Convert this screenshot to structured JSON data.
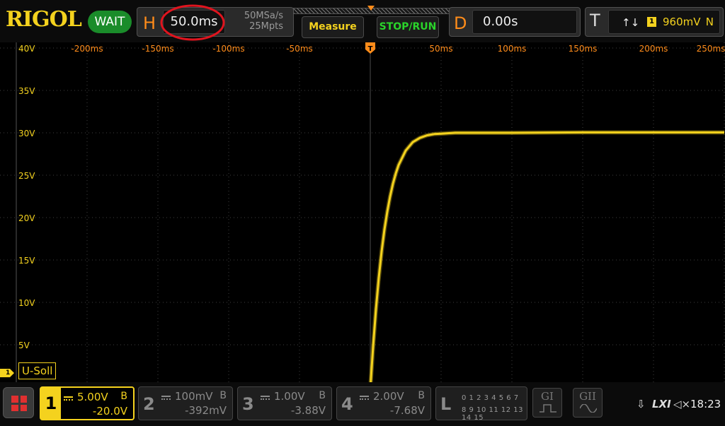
{
  "header": {
    "brand": "RIGOL",
    "run_status": "WAIT",
    "horizontal": {
      "letter": "H",
      "timebase": "50.0ms",
      "sample_rate": "50MSa/s",
      "memory_depth": "25Mpts"
    },
    "buttons": {
      "measure": "Measure",
      "stop_run": "STOP/RUN"
    },
    "delay": {
      "letter": "D",
      "value": "0.00s"
    },
    "trigger": {
      "letter": "T",
      "edge_symbol": "↑↓",
      "source": "1",
      "level": "960mV",
      "mode": "N"
    }
  },
  "screen": {
    "x_ticks": [
      "-200ms",
      "-150ms",
      "-100ms",
      "-50ms",
      "50ms",
      "100ms",
      "150ms",
      "200ms",
      "250ms"
    ],
    "y_ticks": [
      "40V",
      "35V",
      "30V",
      "25V",
      "20V",
      "15V",
      "10V",
      "5V"
    ],
    "channel_label": "U-Soll",
    "channel_marker": "1",
    "trace_color": "#f4d21e",
    "grid_color": "#404040",
    "highlight_color": "#e0141e"
  },
  "chart_data": {
    "type": "line",
    "xlabel": "",
    "ylabel": "",
    "x_unit": "ms",
    "y_unit": "V",
    "xlim": [
      -262,
      250
    ],
    "ylim": [
      -4,
      40
    ],
    "grid": true,
    "series": [
      {
        "x": [
          -262,
          0,
          2,
          4,
          6,
          8,
          10,
          12,
          14,
          16,
          18,
          20,
          25,
          30,
          35,
          40,
          45,
          50,
          60,
          70,
          80,
          90,
          100,
          150,
          200,
          250
        ],
        "y": [
          -0.2,
          -0.2,
          4.8,
          9.2,
          12.9,
          16.0,
          18.6,
          20.7,
          22.5,
          24.0,
          25.2,
          26.2,
          27.9,
          28.9,
          29.4,
          29.7,
          29.85,
          29.9,
          30.0,
          30.0,
          30.0,
          30.0,
          30.0,
          30.05,
          30.05,
          30.05
        ]
      }
    ]
  },
  "footer": {
    "ch1": {
      "num": "1",
      "scale": "5.00V",
      "coupling": "B",
      "offset": "-20.0V"
    },
    "ch2": {
      "num": "2",
      "scale": "100mV",
      "coupling": "B",
      "offset": "-392mV"
    },
    "ch3": {
      "num": "3",
      "scale": "1.00V",
      "coupling": "B",
      "offset": "-3.88V"
    },
    "ch4": {
      "num": "4",
      "scale": "2.00V",
      "coupling": "B",
      "offset": "-7.68V"
    },
    "logic": {
      "letter": "L",
      "row1": "0 1 2 3  4 5 6 7",
      "row2": "8 9 10 11 12 13 14 15"
    },
    "g1_label": "GI",
    "g2_label": "GII",
    "status": {
      "usb_icon": "⇩",
      "lxi": "LXI",
      "sound_icon": "◁×",
      "time": "18:23"
    }
  }
}
